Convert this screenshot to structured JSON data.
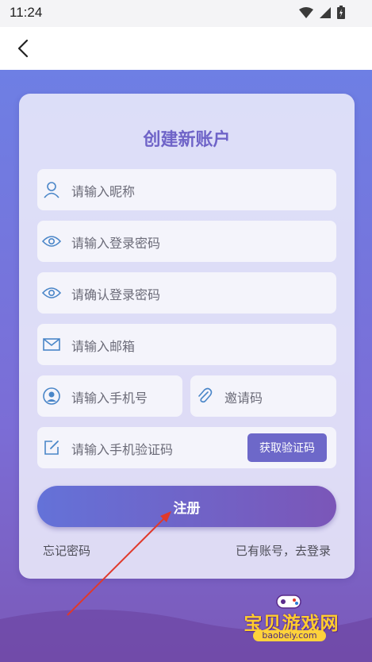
{
  "status_bar": {
    "time": "11:24"
  },
  "form": {
    "title": "创建新账户",
    "nickname_placeholder": "请输入昵称",
    "password_placeholder": "请输入登录密码",
    "confirm_password_placeholder": "请确认登录密码",
    "email_placeholder": "请输入邮箱",
    "phone_placeholder": "请输入手机号",
    "invite_placeholder": "邀请码",
    "sms_code_placeholder": "请输入手机验证码",
    "get_code_label": "获取验证码",
    "register_label": "注册",
    "forgot_password_label": "忘记密码",
    "login_link_label": "已有账号，去登录"
  },
  "watermark": {
    "text": "宝贝游戏网",
    "url": "baobeiy.com"
  },
  "colors": {
    "accent": "#6d68c9",
    "title": "#6f64c8",
    "icon": "#4a86c8"
  }
}
